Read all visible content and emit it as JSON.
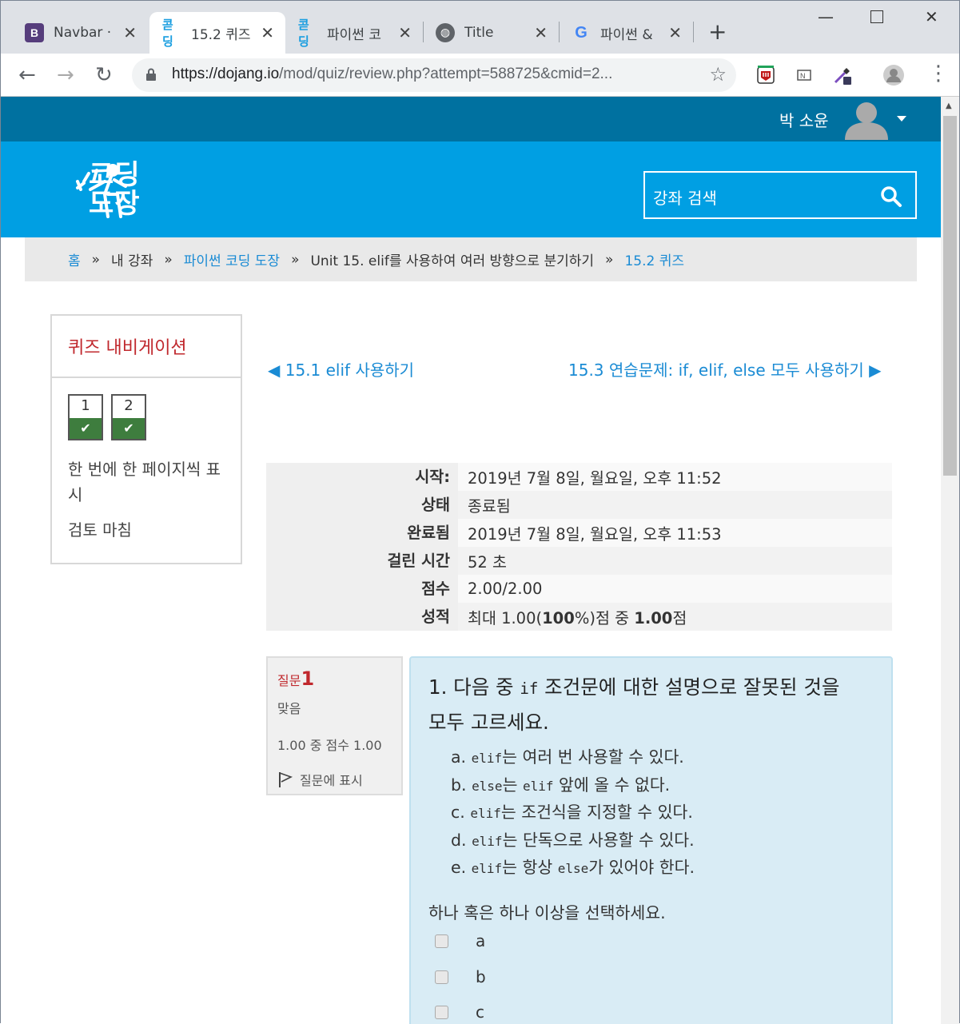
{
  "browser": {
    "tabs": [
      {
        "title": "Navbar ·",
        "favicon": "bootstrap-b"
      },
      {
        "title": "15.2 퀴즈",
        "favicon": "dojang-logo"
      },
      {
        "title": "파이썬 코",
        "favicon": "dojang-logo"
      },
      {
        "title": "Title",
        "favicon": "globe-icon"
      },
      {
        "title": "파이썬 &",
        "favicon": "google-g"
      }
    ],
    "url_host": "https://dojang.io",
    "url_path": "/mod/quiz/review.php?attempt=588725&cmid=2..."
  },
  "site": {
    "user_name": "박 소윤",
    "logo_line1": "코딩",
    "logo_line2": "도장",
    "search_placeholder": "강좌 검색",
    "breadcrumb": [
      "홈",
      "내 강좌",
      "파이썬 코딩 도장",
      "Unit 15. elif를 사용하여 여러 방향으로 분기하기",
      "15.2 퀴즈"
    ]
  },
  "quiz_nav": {
    "title": "퀴즈 내비게이션",
    "questions": [
      "1",
      "2"
    ],
    "show_one_page": "한 번에 한 페이지씩 표시",
    "finish_review": "검토 마침"
  },
  "links": {
    "prev": "◀ 15.1 elif 사용하기",
    "next": "15.3 연습문제: if, elif, else 모두 사용하기 ▶"
  },
  "summary": [
    {
      "label": "시작:",
      "value": "2019년 7월 8일, 월요일, 오후 11:52"
    },
    {
      "label": "상태",
      "value": "종료됨"
    },
    {
      "label": "완료됨",
      "value": "2019년 7월 8일, 월요일, 오후 11:53"
    },
    {
      "label": "걸린 시간",
      "value": "52 초"
    },
    {
      "label": "점수",
      "value": "2.00/2.00"
    },
    {
      "label": "성적",
      "value_pre": "최대 1.00(",
      "value_b1": "100",
      "value_mid": "%)점 중 ",
      "value_b2": "1.00",
      "value_post": "점"
    }
  ],
  "question": {
    "label": "질문",
    "number": "1",
    "state": "맞음",
    "grade": "1.00 중 점수 1.00",
    "flag": "질문에 표시",
    "text_a": "1. 다음 중 ",
    "text_code": "if",
    "text_b": " 조건문에 대한 설명으로 잘못된 것을 모두 고르세요.",
    "options": [
      {
        "letter": "a.",
        "code": "elif",
        "text": "는 여러 번 사용할 수 있다."
      },
      {
        "letter": "b.",
        "code": "else",
        "text": "는 ",
        "code2": "elif",
        "text2": " 앞에 올 수 없다."
      },
      {
        "letter": "c.",
        "code": "elif",
        "text": "는 조건식을 지정할 수 있다."
      },
      {
        "letter": "d.",
        "code": "elif",
        "text": "는 단독으로 사용할 수 있다."
      },
      {
        "letter": "e.",
        "code": "elif",
        "text": "는 항상 ",
        "code2": "else",
        "text2": "가 있어야 한다."
      }
    ],
    "prompt": "하나 혹은 하나 이상을 선택하세요.",
    "choices": [
      "a",
      "b",
      "c"
    ]
  },
  "colors": {
    "user_bar": "#0071a0",
    "brand_bar": "#009fe3",
    "link": "#1a8bd4",
    "correct_green": "#3e7d3e",
    "nav_title": "#c0282d",
    "question_bg": "#d9ecf5"
  }
}
